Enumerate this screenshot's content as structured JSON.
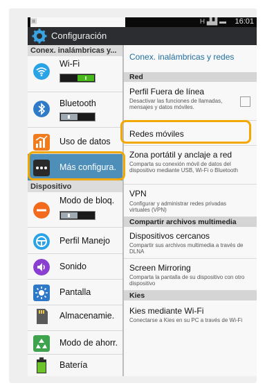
{
  "status_bar": {
    "time": "16:01",
    "network_text": "H",
    "left_icon": "picture-icon"
  },
  "action_bar": {
    "title": "Configuración",
    "icon": "gear-icon"
  },
  "left_pane": {
    "section1": "Conex. inalámbricas y...",
    "wifi": {
      "label": "Wi-Fi",
      "on": true
    },
    "bluetooth": {
      "label": "Bluetooth",
      "on": false
    },
    "data_usage": "Uso de datos",
    "more": "Más configura.",
    "section2": "Dispositivo",
    "block_mode": {
      "label": "Modo de bloq.",
      "on": false
    },
    "profile": "Perfil Manejo",
    "sound": "Sonido",
    "display": "Pantalla",
    "storage": "Almacenamie.",
    "power_saving": "Modo de ahorr.",
    "battery": "Batería"
  },
  "right_pane": {
    "header": "Conex. inalámbricas y redes",
    "sec_red": "Red",
    "airplane": {
      "title": "Perfil Fuera de línea",
      "sub": "Desactivar las funciones de llamadas, mensajes y datos móviles."
    },
    "mobile_networks": "Redes móviles",
    "hotspot": {
      "title": "Zona portátil y anclaje a red",
      "sub": "Comparta su conexión móvil de datos del dispositivo mediante USB, Wi-Fi o Bluetooth"
    },
    "vpn": {
      "title": "VPN",
      "sub": "Configurar y administrar redes privadas virtuales (VPN)"
    },
    "sec_share": "Compartir archivos multimedia",
    "nearby": {
      "title": "Dispositivos cercanos",
      "sub": "Compartir sus archivos multimedia a través de DLNA"
    },
    "mirroring": {
      "title": "Screen Mirroring",
      "sub": "Comparta la pantalla de su dispositivo con otro dispositivo"
    },
    "sec_kies": "Kies",
    "kies": {
      "title": "Kies mediante Wi-Fi",
      "sub": "Conectarse a Kies en su PC a través de Wi-Fi"
    }
  },
  "colors": {
    "accent": "#4d8fb8",
    "highlight": "#f2a800",
    "toggle_on": "#47b91b",
    "header_text": "#1f6fa0"
  }
}
